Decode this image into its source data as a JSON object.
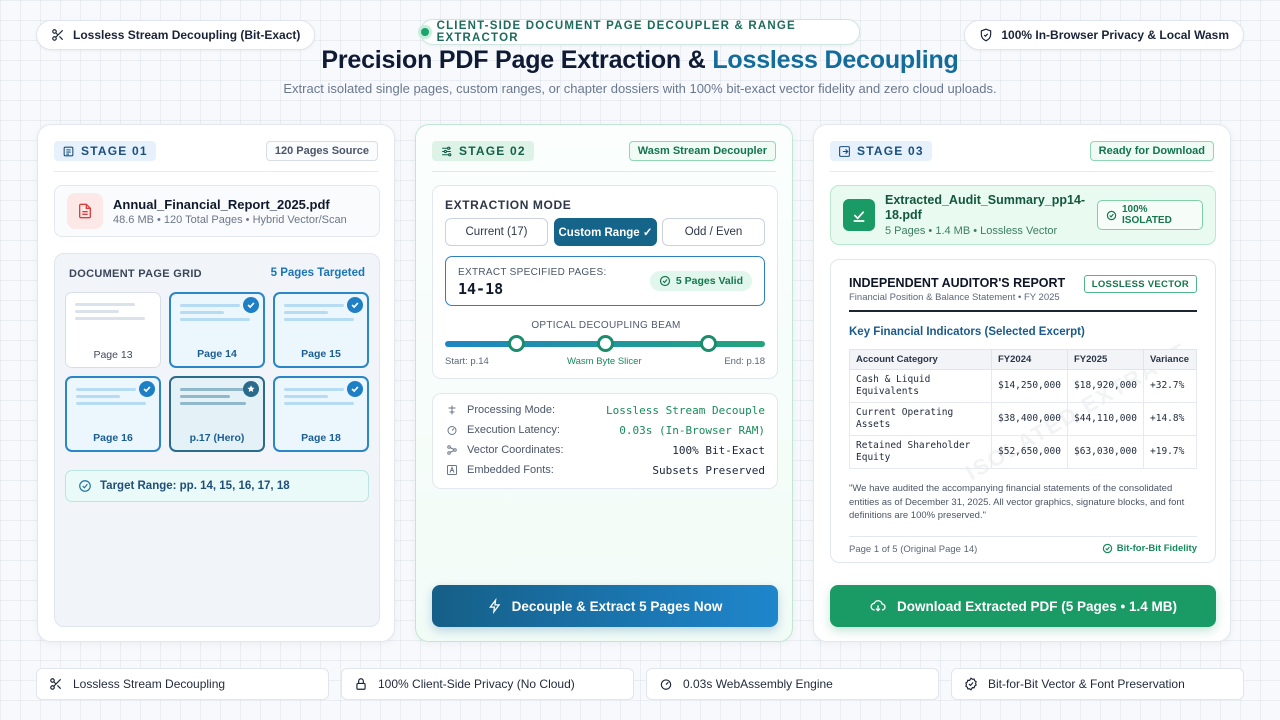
{
  "top_left_pill": "Lossless Stream Decoupling (Bit-Exact)",
  "top_center_pill": "CLIENT-SIDE DOCUMENT PAGE DECOUPLER & RANGE EXTRACTOR",
  "top_right_pill": "100% In-Browser Privacy & Local Wasm",
  "hero": {
    "title_main": "Precision PDF Page Extraction & ",
    "title_accent": "Lossless Decoupling",
    "subtitle": "Extract isolated single pages, custom ranges, or chapter dossiers with 100% bit-exact vector fidelity and zero cloud uploads."
  },
  "stage1": {
    "tag": "STAGE 01",
    "badge": "120 Pages Source",
    "file_name": "Annual_Financial_Report_2025.pdf",
    "file_meta": "48.6 MB • 120 Total Pages • Hybrid Vector/Scan",
    "grid_title": "DOCUMENT PAGE GRID",
    "grid_targeted": "5 Pages Targeted",
    "pages": [
      {
        "label": "Page 13",
        "state": "normal"
      },
      {
        "label": "Page 14",
        "state": "selected"
      },
      {
        "label": "Page 15",
        "state": "selected"
      },
      {
        "label": "Page 16",
        "state": "selected"
      },
      {
        "label": "p.17 (Hero)",
        "state": "hero"
      },
      {
        "label": "Page 18",
        "state": "selected"
      }
    ],
    "target_range": "Target Range: pp. 14, 15, 16, 17, 18"
  },
  "stage2": {
    "tag": "STAGE 02",
    "badge": "Wasm Stream Decoupler",
    "mode_title": "EXTRACTION MODE",
    "modes": [
      "Current (17)",
      "Custom Range ✓",
      "Odd / Even"
    ],
    "active_mode": "Custom Range ✓",
    "range_label": "EXTRACT SPECIFIED PAGES:",
    "range_value": "14-18",
    "range_valid": "5 Pages Valid",
    "beam_title": "OPTICAL DECOUPLING BEAM",
    "beam_start": "Start: p.14",
    "beam_mid": "Wasm Byte Slicer",
    "beam_end": "End: p.18",
    "stats": [
      {
        "label": "Processing Mode:",
        "value": "Lossless Stream Decouple",
        "icon": "sliders-icon"
      },
      {
        "label": "Execution Latency:",
        "value": "0.03s (In-Browser RAM)",
        "icon": "gauge-icon"
      },
      {
        "label": "Vector Coordinates:",
        "value": "100% Bit-Exact",
        "icon": "nodes-icon"
      },
      {
        "label": "Embedded Fonts:",
        "value": "Subsets Preserved",
        "icon": "font-icon"
      }
    ],
    "button": "Decouple & Extract 5 Pages Now"
  },
  "stage3": {
    "tag": "STAGE 03",
    "badge": "Ready for Download",
    "file_name": "Extracted_Audit_Summary_pp14-18.pdf",
    "file_meta": "5 Pages • 1.4 MB • Lossless Vector",
    "iso_badge": "100% ISOLATED",
    "report": {
      "title": "INDEPENDENT AUDITOR'S REPORT",
      "subtitle": "Financial Position & Balance Statement • FY 2025",
      "badge": "LOSSLESS VECTOR",
      "section": "Key Financial Indicators (Selected Excerpt)",
      "columns": [
        "Account Category",
        "FY2024",
        "FY2025",
        "Variance"
      ],
      "rows": [
        [
          "Cash & Liquid Equivalents",
          "$14,250,000",
          "$18,920,000",
          "+32.7%"
        ],
        [
          "Current Operating Assets",
          "$38,400,000",
          "$44,110,000",
          "+14.8%"
        ],
        [
          "Retained Shareholder Equity",
          "$52,650,000",
          "$63,030,000",
          "+19.7%"
        ]
      ],
      "watermark": "ISOLATED EXTRACT",
      "quote": "\"We have audited the accompanying financial statements of the consolidated entities as of December 31, 2025. All vector graphics, signature blocks, and font definitions are 100% preserved.\"",
      "footer": "Page 1 of 5 (Original Page 14)",
      "fidelity": "Bit-for-Bit Fidelity"
    },
    "button": "Download Extracted PDF (5 Pages • 1.4 MB)"
  },
  "footer_features": [
    {
      "label": "Lossless Stream Decoupling",
      "icon": "scissors-icon"
    },
    {
      "label": "100% Client-Side Privacy (No Cloud)",
      "icon": "lock-icon"
    },
    {
      "label": "0.03s WebAssembly Engine",
      "icon": "gauge-icon"
    },
    {
      "label": "Bit-for-Bit Vector & Font Preservation",
      "icon": "badge-check-icon"
    }
  ],
  "colors": {
    "accent_blue": "#136c9b",
    "accent_green": "#1a9a64",
    "page_selected": "#2b86c8",
    "background": "#f7f9fc"
  }
}
